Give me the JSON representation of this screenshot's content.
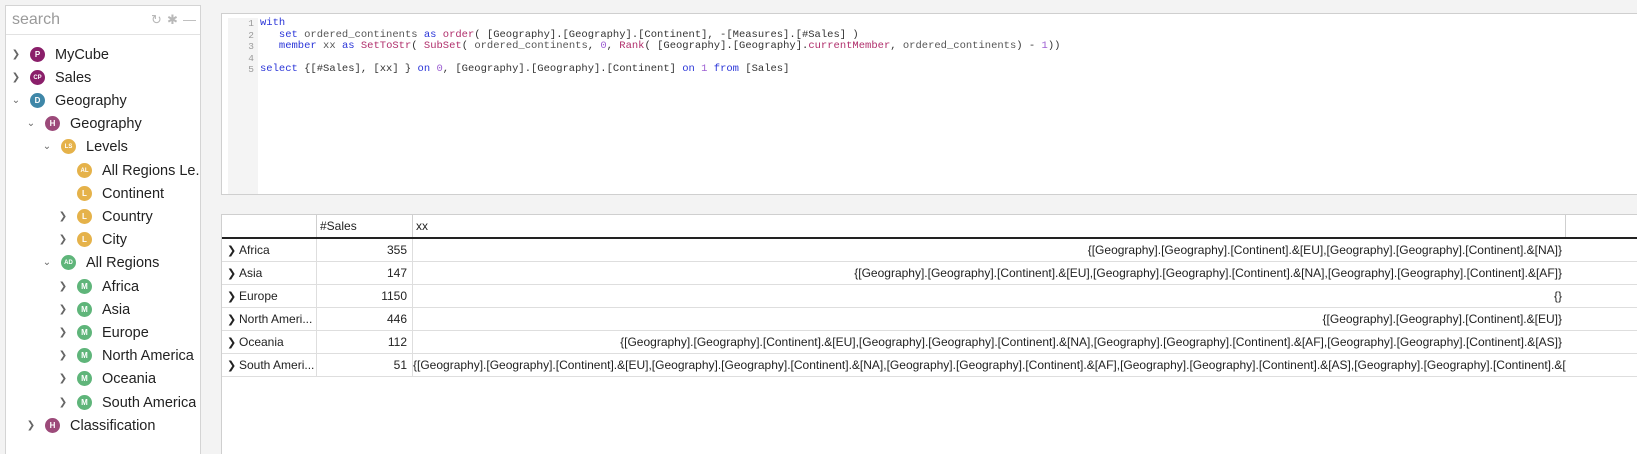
{
  "search": {
    "placeholder": "search"
  },
  "tree": [
    {
      "label": "MyCube",
      "badge": "P",
      "color": "#8a1f6a"
    },
    {
      "label": "Sales",
      "badge": "CP",
      "color": "#8a1f6a"
    },
    {
      "label": "Geography",
      "badge": "D",
      "color": "#3f87a8"
    },
    {
      "label": "Geography",
      "badge": "H",
      "color": "#9c4a7a"
    },
    {
      "label": "Levels",
      "badge": "LS",
      "color": "#e5b24a"
    },
    {
      "label": "All Regions Le...",
      "badge": "AL",
      "color": "#e5b24a"
    },
    {
      "label": "Continent",
      "badge": "L",
      "color": "#e5b24a"
    },
    {
      "label": "Country",
      "badge": "L",
      "color": "#e5b24a"
    },
    {
      "label": "City",
      "badge": "L",
      "color": "#e5b24a"
    },
    {
      "label": "All Regions",
      "badge": "AD",
      "color": "#5fb57a"
    },
    {
      "label": "Africa",
      "badge": "M",
      "color": "#5fb57a"
    },
    {
      "label": "Asia",
      "badge": "M",
      "color": "#5fb57a"
    },
    {
      "label": "Europe",
      "badge": "M",
      "color": "#5fb57a"
    },
    {
      "label": "North America",
      "badge": "M",
      "color": "#5fb57a"
    },
    {
      "label": "Oceania",
      "badge": "M",
      "color": "#5fb57a"
    },
    {
      "label": "South America",
      "badge": "M",
      "color": "#5fb57a"
    },
    {
      "label": "Classification",
      "badge": "H",
      "color": "#9c4a7a"
    }
  ],
  "editor": {
    "line_numbers": [
      "1",
      "2",
      "3",
      "4",
      "5"
    ],
    "code": {
      "l1_kw": "with",
      "l2_kw1": "set",
      "l2_id1": "ordered_continents",
      "l2_kw2": "as",
      "l2_fn": "order",
      "l2_rest": "( [Geography].[Geography].[Continent], -[Measures].[#Sales] )",
      "l3_kw1": "member",
      "l3_id1": "xx",
      "l3_kw2": "as",
      "l3_fn1": "SetToStr",
      "l3_a": "( ",
      "l3_fn2": "SubSet",
      "l3_b": "( ",
      "l3_id2": "ordered_continents",
      "l3_c": ", ",
      "l3_n0": "0",
      "l3_d": ", ",
      "l3_fn3": "Rank",
      "l3_e": "( [Geography].[Geography].",
      "l3_fn4": "currentMember",
      "l3_f": ", ",
      "l3_id3": "ordered_continents",
      "l3_g": ") - ",
      "l3_n1": "1",
      "l3_h": "))",
      "l5_kw1": "select",
      "l5_a": " {[#Sales], [xx] } ",
      "l5_kw2": "on",
      "l5_n0": "0",
      "l5_b": ", [Geography].[Geography].[Continent] ",
      "l5_kw3": "on",
      "l5_n1": "1",
      "l5_kw4": "from",
      "l5_c": " [Sales]"
    }
  },
  "grid": {
    "headers": [
      "",
      "#Sales",
      "xx"
    ],
    "rows": [
      {
        "label": "Africa",
        "sales": "355",
        "xx": "{[Geography].[Geography].[Continent].&[EU],[Geography].[Geography].[Continent].&[NA]}"
      },
      {
        "label": "Asia",
        "sales": "147",
        "xx": "{[Geography].[Geography].[Continent].&[EU],[Geography].[Geography].[Continent].&[NA],[Geography].[Geography].[Continent].&[AF]}"
      },
      {
        "label": "Europe",
        "sales": "1150",
        "xx": "{}"
      },
      {
        "label": "North Ameri...",
        "sales": "446",
        "xx": "{[Geography].[Geography].[Continent].&[EU]}"
      },
      {
        "label": "Oceania",
        "sales": "112",
        "xx": "{[Geography].[Geography].[Continent].&[EU],[Geography].[Geography].[Continent].&[NA],[Geography].[Geography].[Continent].&[AF],[Geography].[Geography].[Continent].&[AS]}"
      },
      {
        "label": "South Ameri...",
        "sales": "51",
        "xx": "{[Geography].[Geography].[Continent].&[EU],[Geography].[Geography].[Continent].&[NA],[Geography].[Geography].[Continent].&[AF],[Geography].[Geography].[Continent].&[AS],[Geography].[Geography].[Continent].&[OC]}"
      }
    ]
  }
}
